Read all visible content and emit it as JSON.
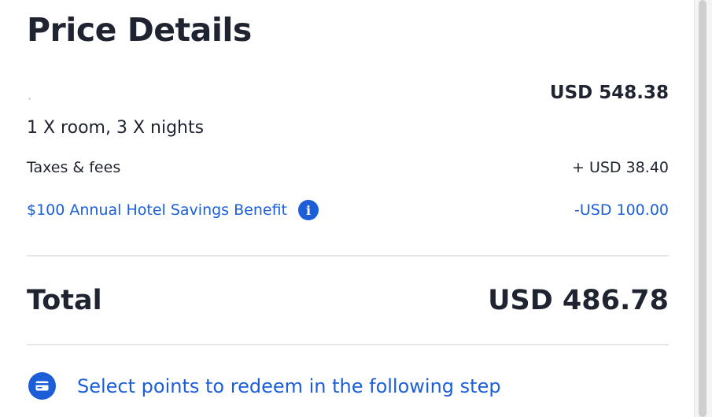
{
  "price_details": {
    "title": "Price Details",
    "base_amount": "USD 548.38",
    "room_summary": "1 X room, 3 X nights",
    "taxes_label": "Taxes & fees",
    "taxes_amount": "+ USD 38.40",
    "benefit_label": "$100 Annual Hotel Savings Benefit",
    "benefit_amount": "-USD 100.00",
    "total_label": "Total",
    "total_amount": "USD 486.78",
    "redeem_text": "Select points to redeem in the following step"
  },
  "icons": {
    "info": "info-icon",
    "card": "credit-card-icon"
  },
  "colors": {
    "text_primary": "#1f2430",
    "accent_blue": "#1b5ed8",
    "divider": "#e5e6ea"
  }
}
